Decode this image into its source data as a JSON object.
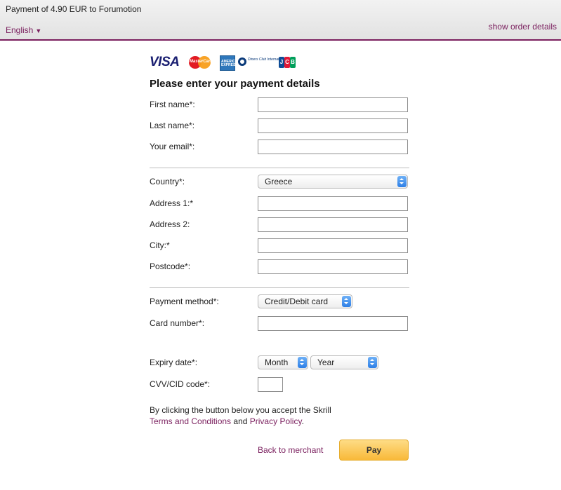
{
  "header": {
    "title": "Payment of 4.90 EUR to Forumotion",
    "language": "English",
    "language_arrow": "▼",
    "show_order_details": "show order details"
  },
  "cards": {
    "visa": "VISA",
    "mastercard": "MasterCard",
    "amex": "AMERICAN EXPRESS",
    "diners": "Diners Club International",
    "jcb": [
      "J",
      "C",
      "B"
    ]
  },
  "form": {
    "heading": "Please enter your payment details",
    "first_name_label": "First name*:",
    "last_name_label": "Last name*:",
    "email_label": "Your email*:",
    "country_label": "Country*:",
    "country_value": "Greece",
    "address1_label": "Address 1:*",
    "address2_label": "Address 2:",
    "city_label": "City:*",
    "postcode_label": "Postcode*:",
    "payment_method_label": "Payment method*:",
    "payment_method_value": "Credit/Debit card",
    "card_number_label": "Card number*:",
    "expiry_label": "Expiry date*:",
    "expiry_month": "Month",
    "expiry_year": "Year",
    "cvv_label": "CVV/CID code*:"
  },
  "terms": {
    "line1": "By clicking the button below you accept the Skrill",
    "terms_link": "Terms and Conditions",
    "and": " and ",
    "privacy_link": "Privacy Policy",
    "period": "."
  },
  "actions": {
    "back": "Back to merchant",
    "pay": "Pay"
  }
}
